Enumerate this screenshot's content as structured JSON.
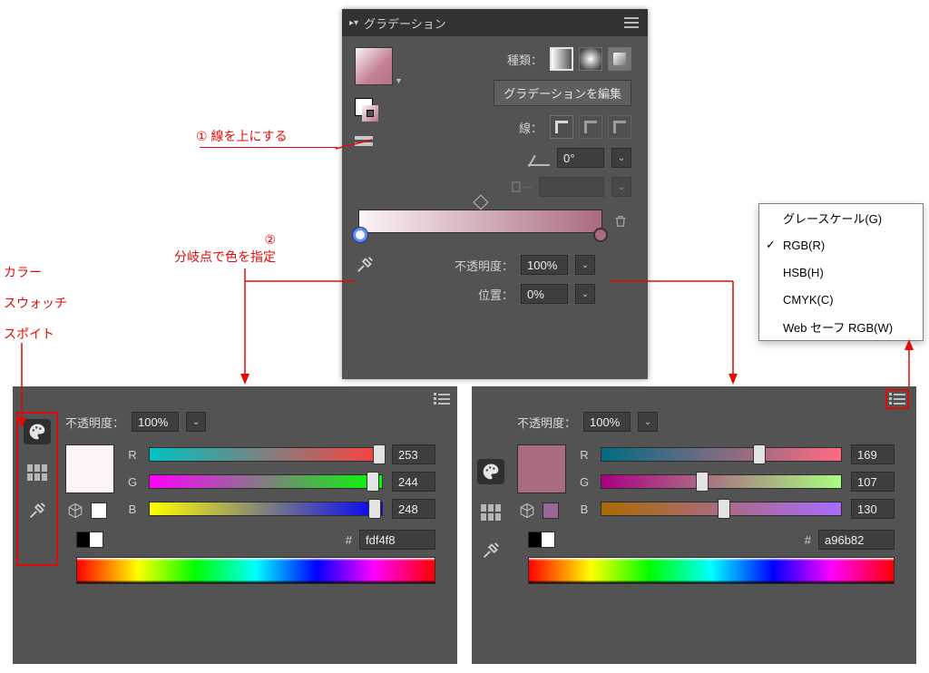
{
  "gradient_panel": {
    "title": "グラデーション",
    "type_label": "種類：",
    "edit_button": "グラデーションを編集",
    "stroke_label": "線：",
    "angle_value": "0°",
    "aspect_value": "",
    "opacity_label": "不透明度：",
    "opacity_value": "100%",
    "position_label": "位置：",
    "position_value": "0%"
  },
  "color_panel_left": {
    "opacity_label": "不透明度：",
    "opacity_value": "100%",
    "swatch_color": "#fdf4f8",
    "R": "253",
    "G": "244",
    "B": "248",
    "r_pct": 99,
    "g_pct": 96,
    "b_pct": 97,
    "hex": "fdf4f8"
  },
  "color_panel_right": {
    "opacity_label": "不透明度：",
    "opacity_value": "100%",
    "swatch_color": "#a96b82",
    "R": "169",
    "G": "107",
    "B": "130",
    "r_pct": 66,
    "g_pct": 42,
    "b_pct": 51,
    "hex": "a96b82"
  },
  "context_menu": {
    "items": [
      {
        "label": "グレースケール(G)",
        "checked": false
      },
      {
        "label": "RGB(R)",
        "checked": true
      },
      {
        "label": "HSB(H)",
        "checked": false
      },
      {
        "label": "CMYK(C)",
        "checked": false
      },
      {
        "label": "Web セーフ RGB(W)",
        "checked": false
      }
    ]
  },
  "annotations": {
    "step1": "線を上にする",
    "step2_line1": "②",
    "step2_line2": "分岐点で色を指定",
    "step1_num": "①",
    "side_labels": [
      "カラー",
      "スウォッチ",
      "スポイト"
    ]
  }
}
